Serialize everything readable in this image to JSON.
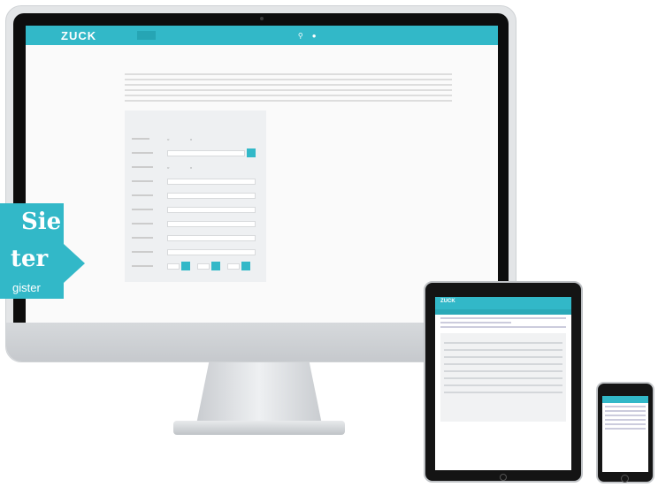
{
  "desktop": {
    "logo": "ZUCK",
    "nav_items": [
      "",
      "",
      "",
      "",
      ""
    ],
    "form_labels": [
      "",
      "",
      "",
      "",
      "",
      "",
      "",
      "",
      "",
      ""
    ]
  },
  "callout": {
    "line1": "Sie",
    "line2": "ter",
    "line3": "gister"
  },
  "tablet": {
    "logo": "ZUCK"
  },
  "colors": {
    "accent": "#32b8c8"
  }
}
